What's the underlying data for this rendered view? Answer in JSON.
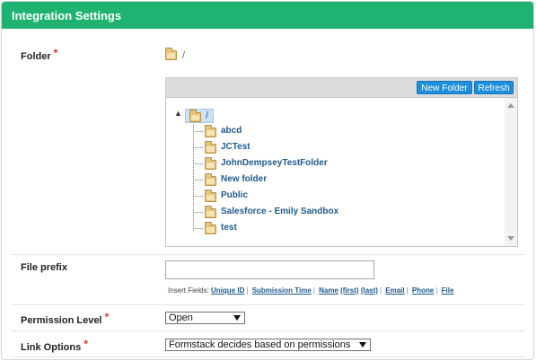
{
  "panel": {
    "title": "Integration Settings",
    "header_color": "#1fb372"
  },
  "folder": {
    "label": "Folder",
    "required_mark": "*",
    "current_path": "/",
    "toolbar": {
      "new_folder_label": "New Folder",
      "refresh_label": "Refresh"
    },
    "tree": {
      "root_label": "/",
      "items": [
        {
          "label": "abcd"
        },
        {
          "label": "JCTest"
        },
        {
          "label": "JohnDempseyTestFolder"
        },
        {
          "label": "New folder"
        },
        {
          "label": "Public"
        },
        {
          "label": "Salesforce - Emily Sandbox"
        },
        {
          "label": "test"
        }
      ]
    }
  },
  "file_prefix": {
    "label": "File prefix",
    "value": "",
    "insert_fields_label": "Insert Fields:",
    "fields": [
      "Unique ID",
      "Submission Time",
      "Name",
      "(first)",
      "(last)",
      "Email",
      "Phone",
      "File"
    ]
  },
  "permission_level": {
    "label": "Permission Level",
    "required_mark": "*",
    "selected": "Open"
  },
  "link_options": {
    "label": "Link Options",
    "required_mark": "*",
    "selected": "Formstack decides based on permissions"
  }
}
